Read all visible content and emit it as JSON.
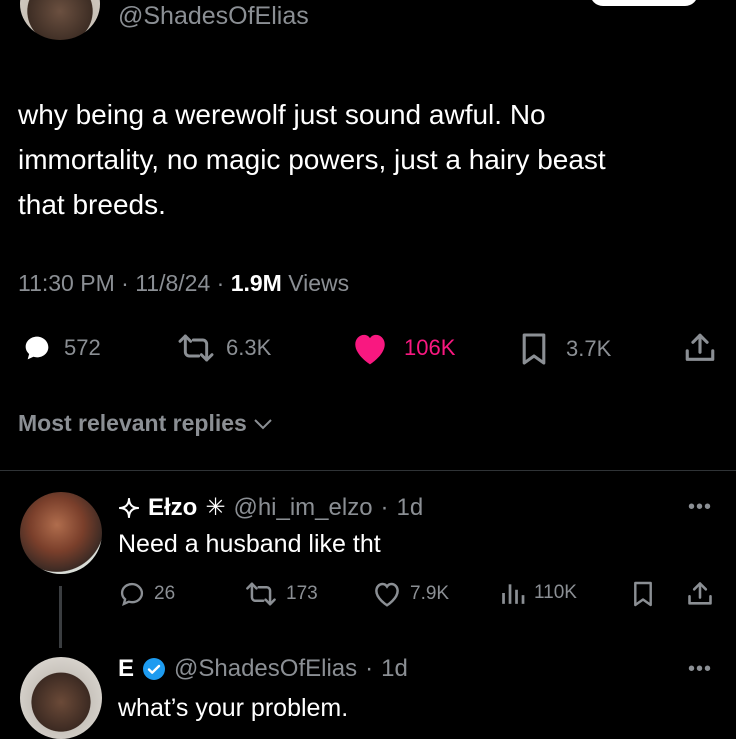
{
  "top": {
    "handle": "@ShadesOfElias"
  },
  "tweet": {
    "text_lines": [
      "why being a werewolf just sound awful. No",
      "immortality, no magic powers, just a hairy beast",
      "that breeds."
    ],
    "time": "11:30 PM",
    "date": "11/8/24",
    "views_count": "1.9M",
    "views_label": "Views",
    "stats": {
      "replies": "572",
      "reposts": "6.3K",
      "likes": "106K",
      "bookmarks": "3.7K"
    },
    "liked": true
  },
  "replies_filter": "Most relevant replies",
  "reply1": {
    "name": "Ełzo",
    "handle": "@hi_im_elzo",
    "age": "1d",
    "text": "Need a husband like tht",
    "stats": {
      "replies": "26",
      "reposts": "173",
      "likes": "7.9K",
      "views": "110K"
    }
  },
  "reply2": {
    "name": "E",
    "handle": "@ShadesOfElias",
    "age": "1d",
    "text": "what’s your problem."
  },
  "colors": {
    "like": "#f91880",
    "muted": "#8b8f94",
    "verified": "#1d9bf0",
    "divider": "#2f3336"
  },
  "icons": [
    "reply-icon",
    "repost-icon",
    "heart-icon",
    "bookmark-icon",
    "share-icon",
    "views-icon",
    "more-icon",
    "verified-icon",
    "sparkle-icon",
    "chevron-down-icon"
  ]
}
